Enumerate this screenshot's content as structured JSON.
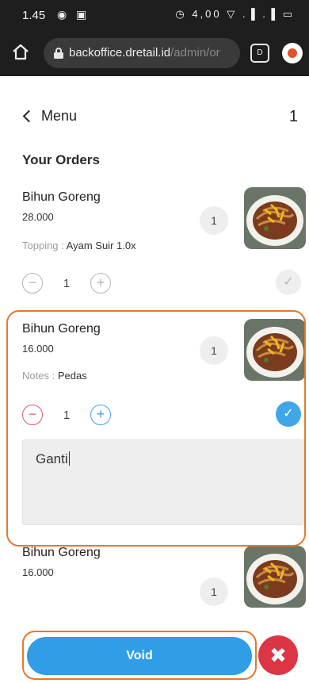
{
  "status_bar": {
    "time": "1.45",
    "left_icons": "◉ ▣",
    "right_icons": "◷ 4,00 ▽ .▐ .▐ ▭"
  },
  "browser": {
    "url_host": "backoffice.dretail.id",
    "url_path": "/admin/or",
    "tabs_count": "D",
    "icons": [
      "home-icon",
      "lock-icon",
      "tabs-icon",
      "extension-icon"
    ]
  },
  "header": {
    "back_label": "Menu",
    "count": "1"
  },
  "section_title": "Your Orders",
  "orders": [
    {
      "name": "Bihun Goreng",
      "price": "28.000",
      "meta_key": "Topping :",
      "meta_value": "Ayam Suir 1.0x",
      "badge_qty": "1",
      "qty": "1",
      "checked": false
    },
    {
      "name": "Bihun Goreng",
      "price": "16.000",
      "meta_key": "Notes :",
      "meta_value": "Pedas",
      "badge_qty": "1",
      "qty": "1",
      "checked": true,
      "note_text": "Ganti"
    },
    {
      "name": "Bihun Goreng",
      "price": "16.000",
      "badge_qty": "1"
    }
  ],
  "actions": {
    "void_label": "Void",
    "close_symbol": "✖"
  },
  "controls": {
    "minus": "−",
    "plus": "+",
    "check": "✓"
  },
  "colors": {
    "accent_blue": "#2f9ee6",
    "danger_red": "#dc3545",
    "highlight_orange": "#e07a30"
  }
}
